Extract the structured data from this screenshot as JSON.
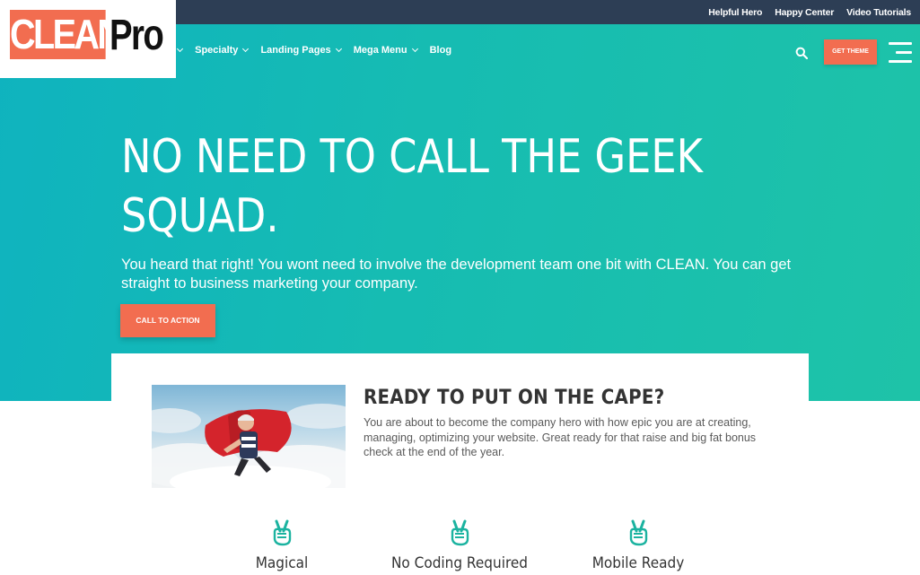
{
  "logo": {
    "part1": "CLEAN",
    "part2": "Pro"
  },
  "topbar": {
    "links": [
      "Helpful Hero",
      "Happy Center",
      "Video Tutorials"
    ]
  },
  "nav": {
    "items": [
      {
        "label": "e"
      },
      {
        "label": "Specialty"
      },
      {
        "label": "Landing Pages"
      },
      {
        "label": "Mega Menu"
      },
      {
        "label": "Blog"
      }
    ],
    "get_theme_label": "GET THEME"
  },
  "hero": {
    "title": "NO NEED TO CALL THE GEEK SQUAD.",
    "subtitle": "You heard that right! You wont need to involve the development team one bit with CLEAN. You can get straight to business marketing your company.",
    "cta_label": "CALL TO ACTION"
  },
  "card": {
    "title": "READY TO PUT ON THE CAPE?",
    "text": "You are about to become the company hero with how epic you are at creating, managing, optimizing your website.  Great ready for that raise and big fat bonus check at the end of the year."
  },
  "features": [
    {
      "label": "Magical",
      "icon": "peace-hand-icon"
    },
    {
      "label": "No Coding Required",
      "icon": "peace-hand-icon"
    },
    {
      "label": "Mobile Ready",
      "icon": "peace-hand-icon"
    }
  ],
  "colors": {
    "accent": "#f26d50",
    "topbar": "#2d3e55",
    "hero_start": "#0fb3bf",
    "hero_end": "#1ec3a8",
    "icon": "#1bb3a0"
  }
}
